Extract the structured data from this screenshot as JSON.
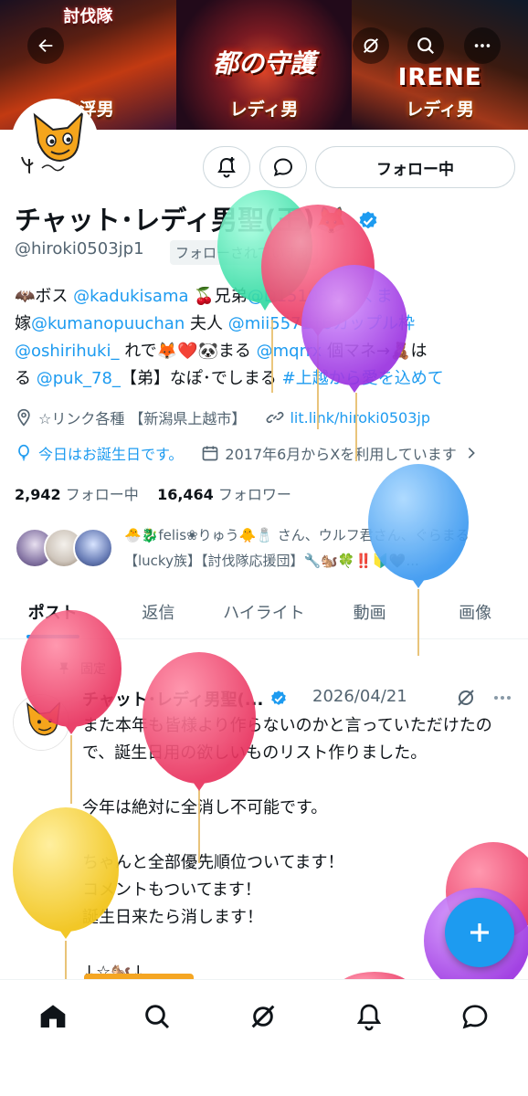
{
  "banner": {
    "panel1_top": "討伐隊",
    "panel1_bottom": "七浮男",
    "panel2_logo": "都の守護",
    "panel2_bottom": "レディ男",
    "panel3_logo": "IRENE",
    "panel3_bottom": "レディ男"
  },
  "profile": {
    "name": "チャット･レディ男聖(王)🦊",
    "handle": "@hiroki0503jp1",
    "follows_you": "フォローされています",
    "follow_button": "フォロー中",
    "bio": {
      "line1_a": "🦇ボス",
      "line1_mention1": "@kadukisama",
      "line1_b": "🍒兄弟",
      "line1_mention2": "@D",
      "line1_c": "151055🐻‍❄️くま",
      "line2_a": "嫁",
      "line2_mention1": "@kumanopuuchan",
      "line2_b": "夫人",
      "line2_mention2": "@mii",
      "line2_c": "557116カップル枠",
      "line3_mention1": "@oshirihuki_",
      "line3_a": "れで🦊❤️🐼まる",
      "line3_mention2": "@",
      "line3_b": "mqrrx",
      "line3_c": "個マネ→🧸は",
      "line4_a": "る",
      "line4_mention1": "@puk_78_",
      "line4_b": "【弟】なぽ･でしまる",
      "line4_hashtag": "#上越から愛を込めて"
    },
    "location_links": "☆リンク各種 【新潟県上越市】",
    "website": "lit.link/hiroki0503jp",
    "birthday": "今日はお誕生日です。",
    "joined": "2017年6月からXを利用しています",
    "following_count": "2,942",
    "following_label": "フォロー中",
    "followers_count": "16,464",
    "followers_label": "フォロワー",
    "followed_by": "🐣🐉felis❀りゅう🐥🧂 さん、ウルフ君さん、ぐらまる【lucky族】【討伐隊応援団】🔧🐿️🍀‼️🔰🖤..."
  },
  "tabs": [
    "ポスト",
    "返信",
    "ハイライト",
    "動画",
    "画像"
  ],
  "post": {
    "pinned_label": "固定",
    "author": "チャット･レディ男聖(...",
    "date": "2026/04/21",
    "text": "また本年も皆様より作らないのかと言っていただけたので、誕生日用の欲しいものリスト作りました。\n\n今年は絶対に全消し不可能です。\n\nちゃんと全部優先順位ついてます！\nコメントもついてます！\n誕生日来たら消します！\n\n↓☆🐿️↓"
  },
  "colors": {
    "accent": "#1d9bf0",
    "balloon_green": "#3de8b0",
    "balloon_pink": "#f0456e",
    "balloon_purple": "#a845e6",
    "balloon_blue": "#4aa8f5",
    "balloon_yellow": "#f7d33a"
  },
  "icons": {
    "top": [
      "back-arrow-icon",
      "grok-icon",
      "search-icon",
      "more-icon"
    ],
    "bottom_nav": [
      "home-icon",
      "search-icon",
      "grok-icon",
      "notifications-icon",
      "messages-icon"
    ]
  }
}
